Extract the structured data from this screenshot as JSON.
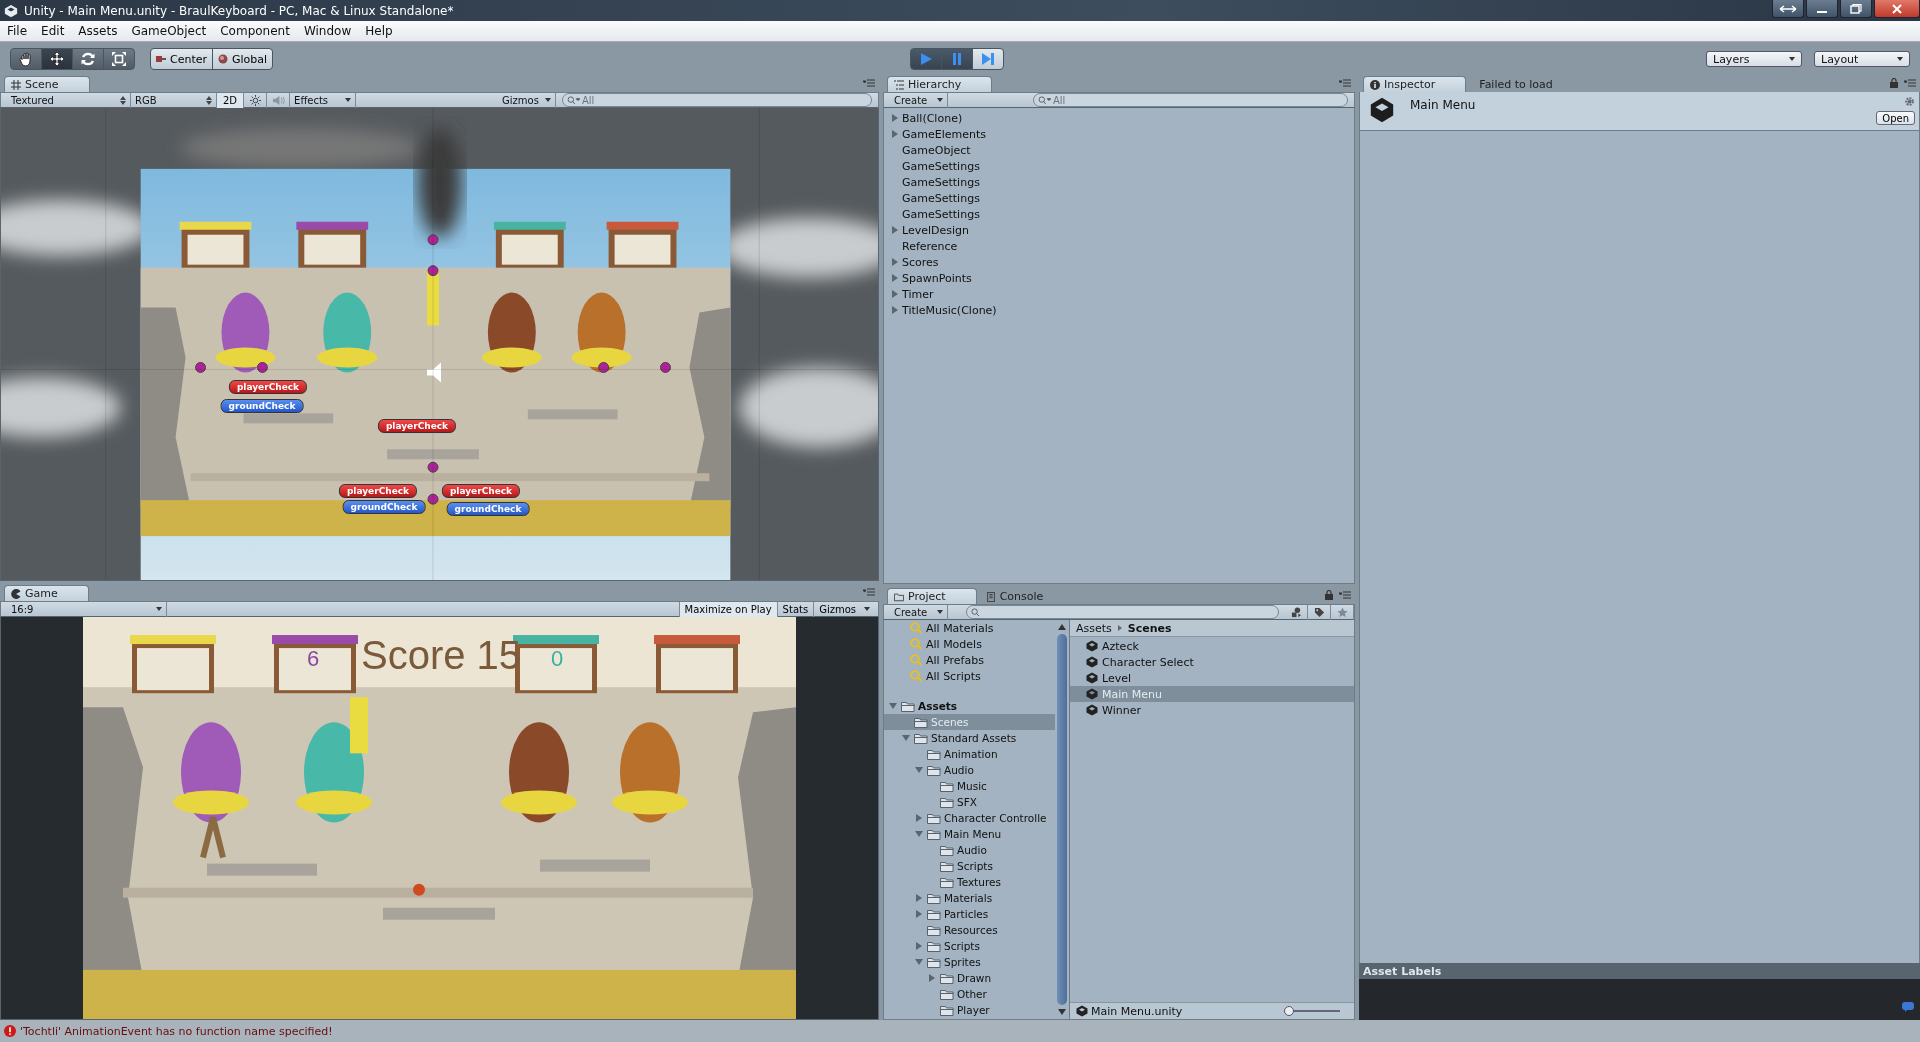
{
  "window": {
    "title": "Unity - Main Menu.unity - BraulKeyboard - PC, Mac & Linux Standalone*"
  },
  "menu": [
    "File",
    "Edit",
    "Assets",
    "GameObject",
    "Component",
    "Window",
    "Help"
  ],
  "toolbar": {
    "tools": [
      {
        "kind": "hand",
        "selected": false
      },
      {
        "kind": "move",
        "selected": true
      },
      {
        "kind": "rotate",
        "selected": false
      },
      {
        "kind": "scale",
        "selected": false
      }
    ],
    "pivot": [
      {
        "label": "Center",
        "kind": "pivot"
      },
      {
        "label": "Global",
        "kind": "global"
      }
    ],
    "play": [
      {
        "kind": "play",
        "on": true
      },
      {
        "kind": "pause",
        "on": true
      },
      {
        "kind": "step",
        "on": false
      }
    ],
    "layers": "Layers",
    "layout": "Layout"
  },
  "scene": {
    "tab": "Scene",
    "shading": "Textured",
    "channel": "RGB",
    "mode_2d": "2D",
    "lighting": {
      "on": false
    },
    "audio": {
      "on": false
    },
    "effects": "Effects",
    "gizmos": "Gizmos",
    "search_placeholder": "All",
    "labels": [
      {
        "text": "playerCheck",
        "kind": "player"
      },
      {
        "text": "groundCheck",
        "kind": "ground"
      },
      {
        "text": "playerCheck",
        "kind": "player"
      },
      {
        "text": "playerCheck",
        "kind": "player"
      },
      {
        "text": "groundCheck",
        "kind": "ground"
      },
      {
        "text": "playerCheck",
        "kind": "player"
      },
      {
        "text": "groundCheck",
        "kind": "ground"
      }
    ]
  },
  "game": {
    "tab": "Game",
    "aspect": "16:9",
    "buttons": [
      {
        "label": "Maximize on Play",
        "on": true
      },
      {
        "label": "Stats",
        "on": false
      },
      {
        "label": "Gizmos",
        "on": false
      }
    ],
    "hud": [
      {
        "text": "6",
        "kind": "left_score"
      },
      {
        "text": "Score 15",
        "kind": "title"
      },
      {
        "text": "0",
        "kind": "right_score"
      }
    ]
  },
  "hierarchy": {
    "tab": "Hierarchy",
    "create": "Create",
    "search_placeholder": "All",
    "items": [
      {
        "label": "Ball(Clone)",
        "expandable": true
      },
      {
        "label": "GameElements",
        "expandable": true
      },
      {
        "label": "GameObject",
        "expandable": false
      },
      {
        "label": "GameSettings",
        "expandable": false
      },
      {
        "label": "GameSettings",
        "expandable": false
      },
      {
        "label": "GameSettings",
        "expandable": false
      },
      {
        "label": "GameSettings",
        "expandable": false
      },
      {
        "label": "LevelDesign",
        "expandable": true
      },
      {
        "label": "Reference",
        "expandable": false
      },
      {
        "label": "Scores",
        "expandable": true
      },
      {
        "label": "SpawnPoints",
        "expandable": true
      },
      {
        "label": "Timer",
        "expandable": true
      },
      {
        "label": "TitleMusic(Clone)",
        "expandable": true
      }
    ]
  },
  "inspector": {
    "tabs": [
      {
        "label": "Inspector",
        "selected": true
      },
      {
        "label": "Failed to load",
        "selected": false
      }
    ],
    "asset_name": "Main Menu",
    "open_button": "Open",
    "labels_title": "Asset Labels"
  },
  "project": {
    "tabs": [
      {
        "label": "Project",
        "selected": true
      },
      {
        "label": "Console",
        "selected": false
      }
    ],
    "create": "Create",
    "favorites": [
      "All Materials",
      "All Models",
      "All Prefabs",
      "All Scripts"
    ],
    "tree": [
      {
        "label": "Assets",
        "expandable": true,
        "expanded": true,
        "selected": false,
        "children": [
          {
            "label": "Scenes",
            "expandable": false,
            "selected": true
          },
          {
            "label": "Standard Assets",
            "expandable": true,
            "expanded": true,
            "selected": false,
            "children": [
              {
                "label": "Animation",
                "expandable": false,
                "selected": false
              },
              {
                "label": "Audio",
                "expandable": true,
                "expanded": true,
                "selected": false,
                "children": [
                  {
                    "label": "Music",
                    "expandable": false,
                    "selected": false
                  },
                  {
                    "label": "SFX",
                    "expandable": false,
                    "selected": false
                  }
                ]
              },
              {
                "label": "Character Controlle",
                "expandable": true,
                "expanded": false,
                "selected": false
              },
              {
                "label": "Main Menu",
                "expandable": true,
                "expanded": true,
                "selected": false,
                "children": [
                  {
                    "label": "Audio",
                    "expandable": false,
                    "selected": false
                  },
                  {
                    "label": "Scripts",
                    "expandable": false,
                    "selected": false
                  },
                  {
                    "label": "Textures",
                    "expandable": false,
                    "selected": false
                  }
                ]
              },
              {
                "label": "Materials",
                "expandable": true,
                "expanded": false,
                "selected": false
              },
              {
                "label": "Particles",
                "expandable": true,
                "expanded": false,
                "selected": false
              },
              {
                "label": "Resources",
                "expandable": false,
                "selected": false
              },
              {
                "label": "Scripts",
                "expandable": true,
                "expanded": false,
                "selected": false
              },
              {
                "label": "Sprites",
                "expandable": true,
                "expanded": true,
                "selected": false,
                "children": [
                  {
                    "label": "Drawn",
                    "expandable": true,
                    "expanded": false,
                    "selected": false
                  },
                  {
                    "label": "Other",
                    "expandable": false,
                    "selected": false
                  },
                  {
                    "label": "Player",
                    "expandable": false,
                    "selected": false
                  }
                ]
              }
            ]
          }
        ]
      }
    ],
    "breadcrumb": [
      "Assets",
      "Scenes"
    ],
    "files": [
      {
        "label": "Azteck",
        "selected": false
      },
      {
        "label": "Character Select",
        "selected": false
      },
      {
        "label": "Level",
        "selected": false
      },
      {
        "label": "Main Menu",
        "selected": true
      },
      {
        "label": "Winner",
        "selected": false
      }
    ],
    "footer": "Main Menu.unity",
    "icon_size": {
      "level": 0
    }
  },
  "status": {
    "message": "'Tochtli' AnimationEvent has no function name specified!"
  }
}
